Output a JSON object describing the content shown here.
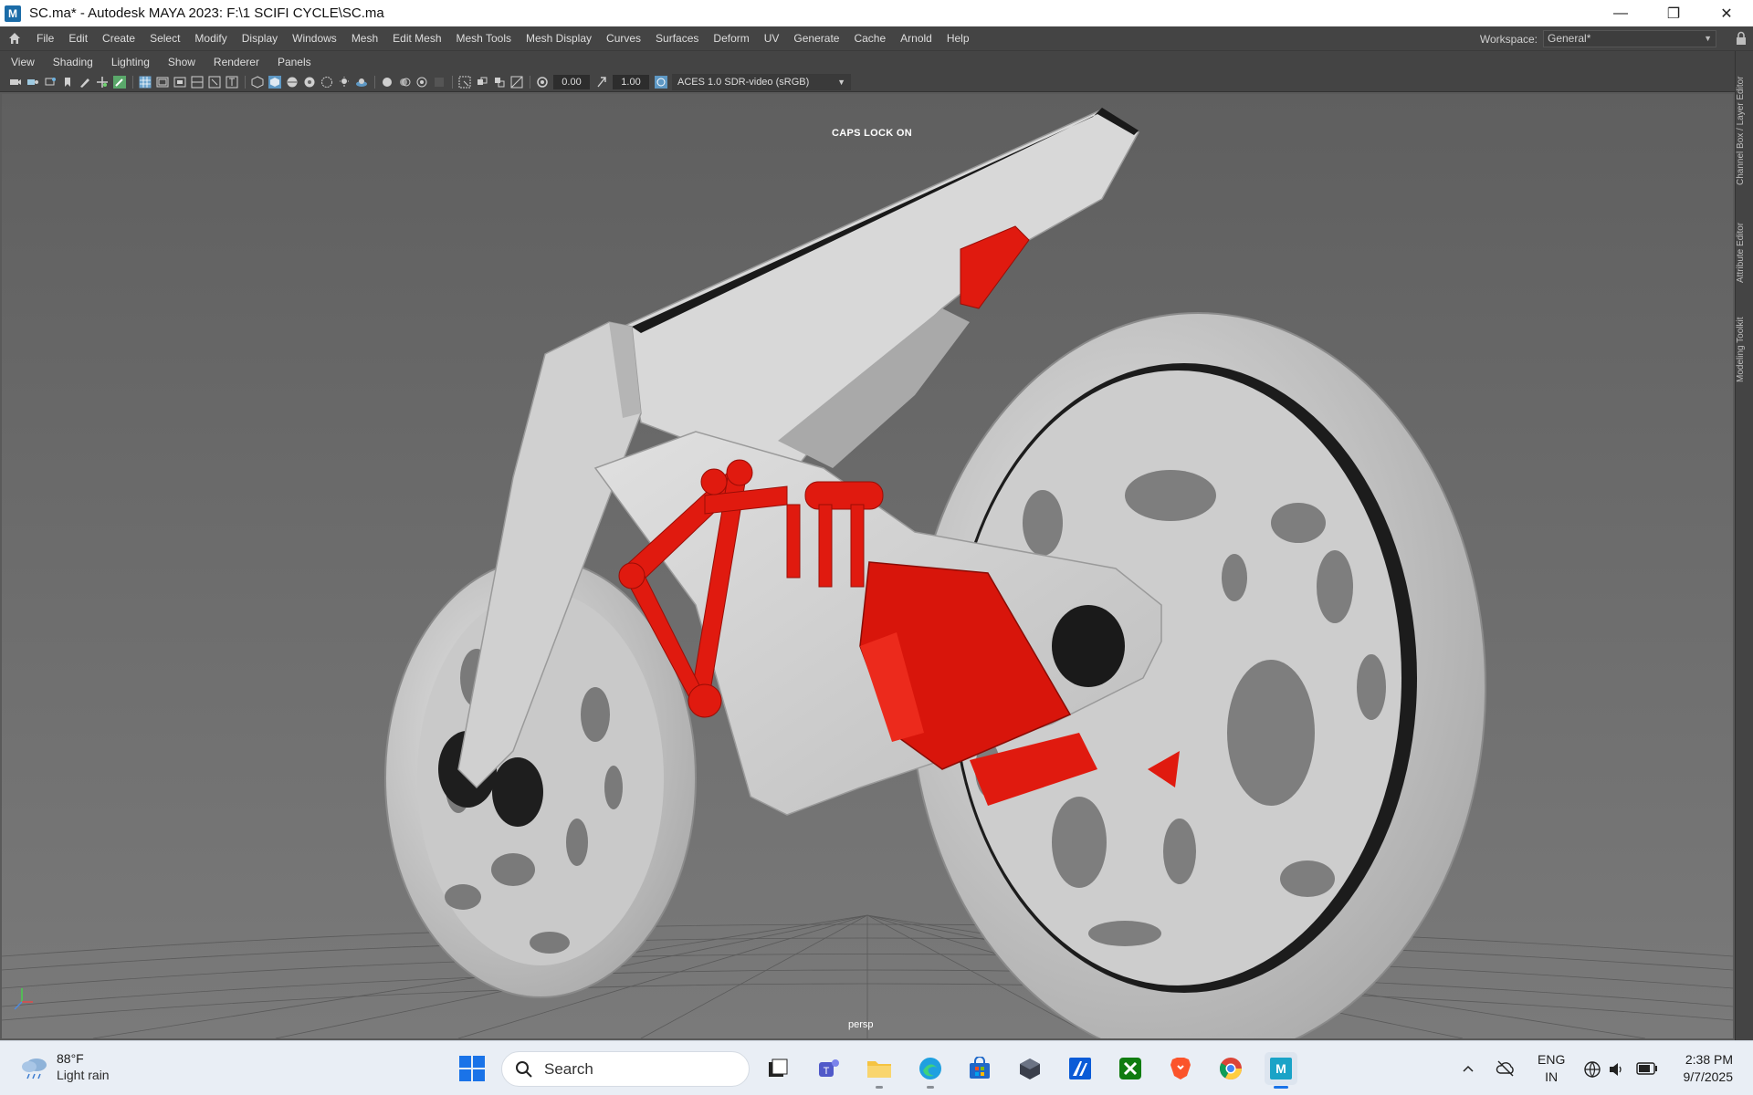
{
  "window": {
    "title": "SC.ma* - Autodesk MAYA 2023: F:\\1 SCIFI CYCLE\\SC.ma",
    "app_icon_letter": "M",
    "controls": {
      "minimize": "—",
      "restore": "❐",
      "close": "✕"
    }
  },
  "main_menu": {
    "items": [
      "File",
      "Edit",
      "Create",
      "Select",
      "Modify",
      "Display",
      "Windows",
      "Mesh",
      "Edit Mesh",
      "Mesh Tools",
      "Mesh Display",
      "Curves",
      "Surfaces",
      "Deform",
      "UV",
      "Generate",
      "Cache",
      "Arnold",
      "Help"
    ],
    "workspace_label": "Workspace:",
    "workspace_value": "General*"
  },
  "panel_menu": {
    "items": [
      "View",
      "Shading",
      "Lighting",
      "Show",
      "Renderer",
      "Panels"
    ]
  },
  "panel_toolbar": {
    "exposure_value": "0.00",
    "gamma_value": "1.00",
    "color_transform": "ACES 1.0 SDR-video (sRGB)"
  },
  "viewport": {
    "caps_lock_notice": "CAPS LOCK ON",
    "camera_name": "persp",
    "background_color": "#6d6d6d",
    "model_colors": {
      "body": "#d2d2d2",
      "accent": "#e01a0f",
      "tire": "#bdbdbd",
      "dark": "#1c1c1c"
    }
  },
  "side_tabs": [
    "Channel Box / Layer Editor",
    "Attribute Editor",
    "Modeling Toolkit"
  ],
  "taskbar": {
    "weather_temp": "88°F",
    "weather_condition": "Light rain",
    "search_placeholder": "Search",
    "apps": [
      "file-explorer-icon",
      "teams-icon",
      "folder-icon",
      "edge-icon",
      "store-icon",
      "box-app-icon",
      "autodesk-icon",
      "xbox-icon",
      "brave-icon",
      "chrome-icon",
      "maya-icon"
    ],
    "language_line1": "ENG",
    "language_line2": "IN",
    "time": "2:38 PM",
    "date": "9/7/2025"
  }
}
